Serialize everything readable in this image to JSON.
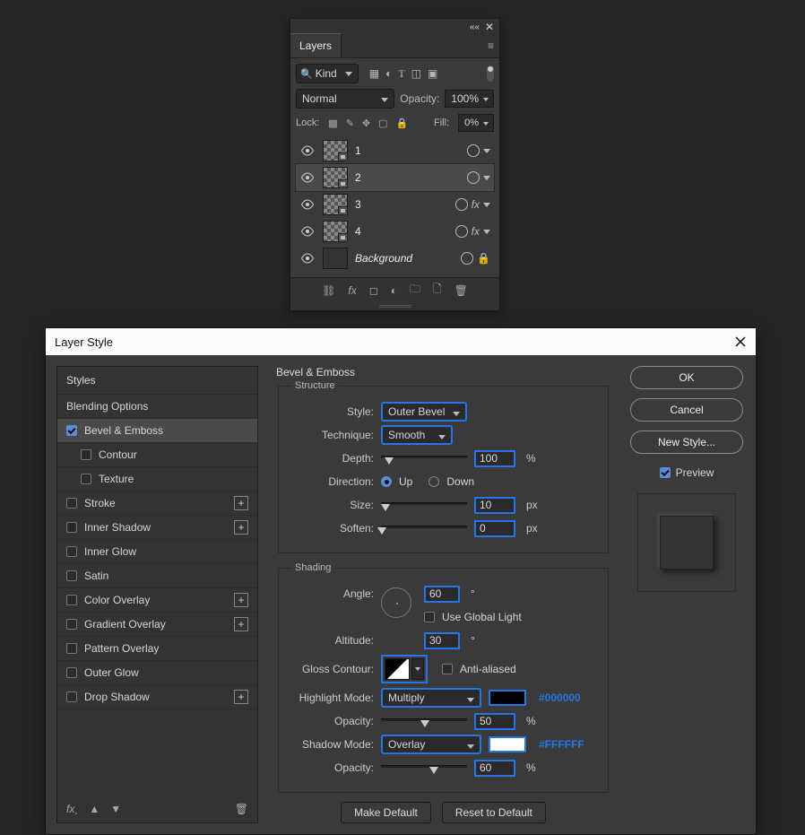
{
  "layers_panel": {
    "tab_label": "Layers",
    "filter_label": "Kind",
    "blend_mode": "Normal",
    "opacity_label": "Opacity:",
    "opacity_value": "100%",
    "lock_label": "Lock:",
    "fill_label": "Fill:",
    "fill_value": "0%",
    "items": [
      {
        "name": "1",
        "fx": false,
        "selected": false,
        "locked": false,
        "bg": false
      },
      {
        "name": "2",
        "fx": false,
        "selected": true,
        "locked": false,
        "bg": false
      },
      {
        "name": "3",
        "fx": true,
        "selected": false,
        "locked": false,
        "bg": false
      },
      {
        "name": "4",
        "fx": true,
        "selected": false,
        "locked": false,
        "bg": false
      },
      {
        "name": "Background",
        "fx": false,
        "selected": false,
        "locked": true,
        "bg": true
      }
    ]
  },
  "dialog": {
    "title": "Layer Style",
    "styles_header": "Styles",
    "list": {
      "blending": "Blending Options",
      "bevel": "Bevel & Emboss",
      "contour": "Contour",
      "texture": "Texture",
      "stroke": "Stroke",
      "inner_shadow": "Inner Shadow",
      "inner_glow": "Inner Glow",
      "satin": "Satin",
      "color_overlay": "Color Overlay",
      "gradient_overlay": "Gradient Overlay",
      "pattern_overlay": "Pattern Overlay",
      "outer_glow": "Outer Glow",
      "drop_shadow": "Drop Shadow"
    },
    "section_title": "Bevel & Emboss",
    "structure": {
      "legend": "Structure",
      "style_label": "Style:",
      "style_value": "Outer Bevel",
      "technique_label": "Technique:",
      "technique_value": "Smooth",
      "depth_label": "Depth:",
      "depth_value": "100",
      "depth_unit": "%",
      "direction_label": "Direction:",
      "direction_up": "Up",
      "direction_down": "Down",
      "size_label": "Size:",
      "size_value": "10",
      "size_unit": "px",
      "soften_label": "Soften:",
      "soften_value": "0",
      "soften_unit": "px"
    },
    "shading": {
      "legend": "Shading",
      "angle_label": "Angle:",
      "angle_value": "60",
      "angle_unit": "°",
      "global_light": "Use Global Light",
      "altitude_label": "Altitude:",
      "altitude_value": "30",
      "altitude_unit": "°",
      "gloss_label": "Gloss Contour:",
      "anti_aliased": "Anti-aliased",
      "highlight_mode_label": "Highlight Mode:",
      "highlight_mode_value": "Multiply",
      "highlight_color": "#000000",
      "highlight_hex": "#000000",
      "highlight_opacity_label": "Opacity:",
      "highlight_opacity_value": "50",
      "highlight_opacity_unit": "%",
      "shadow_mode_label": "Shadow Mode:",
      "shadow_mode_value": "Overlay",
      "shadow_color": "#FFFFFF",
      "shadow_hex": "#FFFFFF",
      "shadow_opacity_label": "Opacity:",
      "shadow_opacity_value": "60",
      "shadow_opacity_unit": "%"
    },
    "make_default": "Make Default",
    "reset_default": "Reset to Default",
    "buttons": {
      "ok": "OK",
      "cancel": "Cancel",
      "new_style": "New Style...",
      "preview": "Preview"
    }
  }
}
